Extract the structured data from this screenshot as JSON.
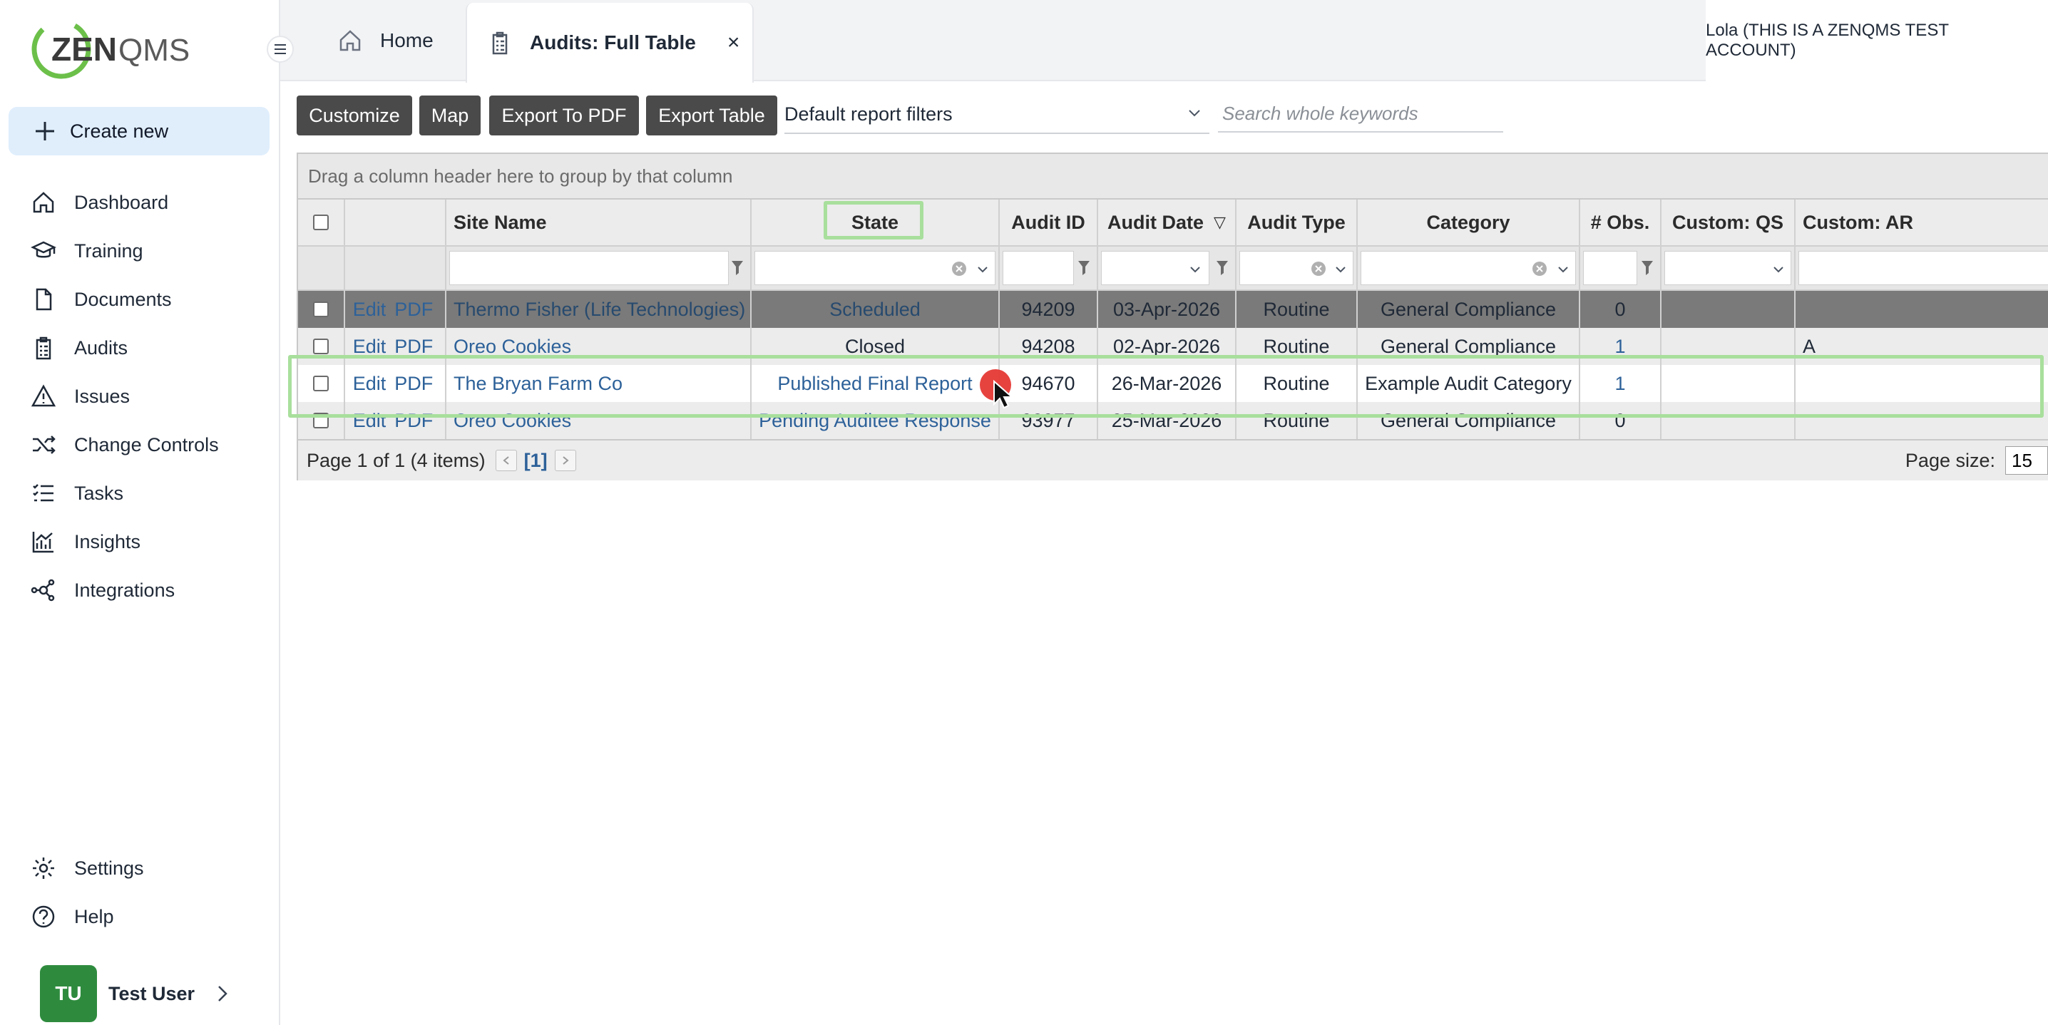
{
  "sidebar": {
    "logo_text": "ZENQMS",
    "create_new_label": "Create new",
    "nav": [
      {
        "label": "Dashboard",
        "icon": "home-icon"
      },
      {
        "label": "Training",
        "icon": "graduation-cap-icon"
      },
      {
        "label": "Documents",
        "icon": "document-icon"
      },
      {
        "label": "Audits",
        "icon": "clipboard-icon"
      },
      {
        "label": "Issues",
        "icon": "warning-icon"
      },
      {
        "label": "Change Controls",
        "icon": "shuffle-icon"
      },
      {
        "label": "Tasks",
        "icon": "checklist-icon"
      },
      {
        "label": "Insights",
        "icon": "chart-icon"
      },
      {
        "label": "Integrations",
        "icon": "network-icon"
      }
    ],
    "settings_label": "Settings",
    "help_label": "Help",
    "user": {
      "initials": "TU",
      "name": "Test User"
    }
  },
  "tabs": {
    "home": "Home",
    "active": "Audits: Full Table",
    "close": "×"
  },
  "account": "Lola (THIS IS A ZENQMS TEST ACCOUNT)",
  "toolbar": {
    "customize": "Customize",
    "map": "Map",
    "export_pdf": "Export To PDF",
    "export_table": "Export Table",
    "filter_selected": "Default report filters",
    "search_placeholder": "Search whole keywords"
  },
  "grid": {
    "group_hint": "Drag a column header here to group by that column",
    "columns": [
      "Site Name",
      "State",
      "Audit ID",
      "Audit Date",
      "Audit Type",
      "Category",
      "# Obs.",
      "Custom: QS",
      "Custom: AR"
    ],
    "sort_indicator": "▽",
    "row_actions": {
      "edit": "Edit",
      "pdf": "PDF"
    },
    "rows": [
      {
        "site": "Thermo Fisher (Life Technologies)",
        "state": "Scheduled",
        "audit_id": "94209",
        "date": "03-Apr-2026",
        "type": "Routine",
        "category": "General Compliance",
        "obs": "0",
        "qs": "",
        "ar": ""
      },
      {
        "site": "Oreo Cookies",
        "state": "Closed",
        "audit_id": "94208",
        "date": "02-Apr-2026",
        "type": "Routine",
        "category": "General Compliance",
        "obs": "1",
        "qs": "",
        "ar": "A"
      },
      {
        "site": "The Bryan Farm Co",
        "state": "Published Final Report",
        "audit_id": "94670",
        "date": "26-Mar-2026",
        "type": "Routine",
        "category": "Example Audit Category",
        "obs": "1",
        "qs": "",
        "ar": ""
      },
      {
        "site": "Oreo Cookies",
        "state": "Pending Auditee Response",
        "audit_id": "93977",
        "date": "25-Mar-2026",
        "type": "Routine",
        "category": "General Compliance",
        "obs": "0",
        "qs": "",
        "ar": ""
      }
    ],
    "pager": {
      "summary": "Page 1 of 1 (4 items)",
      "current": "[1]",
      "page_size_label": "Page size:",
      "page_size": "15"
    }
  },
  "colors": {
    "accent": "#2d6199",
    "highlight": "#a8df9c",
    "click_marker": "#e53935",
    "avatar": "#2e8b3e"
  }
}
